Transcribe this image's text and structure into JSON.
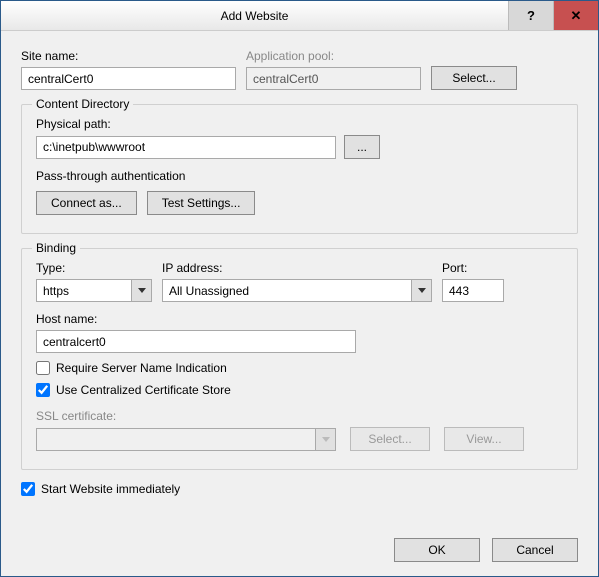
{
  "window_title": "Add Website",
  "site_name_label": "Site name:",
  "site_name_value": "centralCert0",
  "app_pool_label": "Application pool:",
  "app_pool_value": "centralCert0",
  "select_btn": "Select...",
  "content_dir": {
    "title": "Content Directory",
    "path_label": "Physical path:",
    "path_value": "c:\\inetpub\\wwwroot",
    "browse_btn": "...",
    "auth_label": "Pass-through authentication",
    "connect_btn": "Connect as...",
    "test_btn": "Test Settings..."
  },
  "binding": {
    "title": "Binding",
    "type_label": "Type:",
    "type_value": "https",
    "ip_label": "IP address:",
    "ip_value": "All Unassigned",
    "port_label": "Port:",
    "port_value": "443",
    "host_label": "Host name:",
    "host_value": "centralcert0",
    "require_sni_label": "Require Server Name Indication",
    "require_sni_checked": false,
    "use_ccs_label": "Use Centralized Certificate Store",
    "use_ccs_checked": true,
    "ssl_label": "SSL certificate:",
    "ssl_value": "",
    "ssl_select_btn": "Select...",
    "ssl_view_btn": "View..."
  },
  "start_label": "Start Website immediately",
  "start_checked": true,
  "ok_btn": "OK",
  "cancel_btn": "Cancel"
}
